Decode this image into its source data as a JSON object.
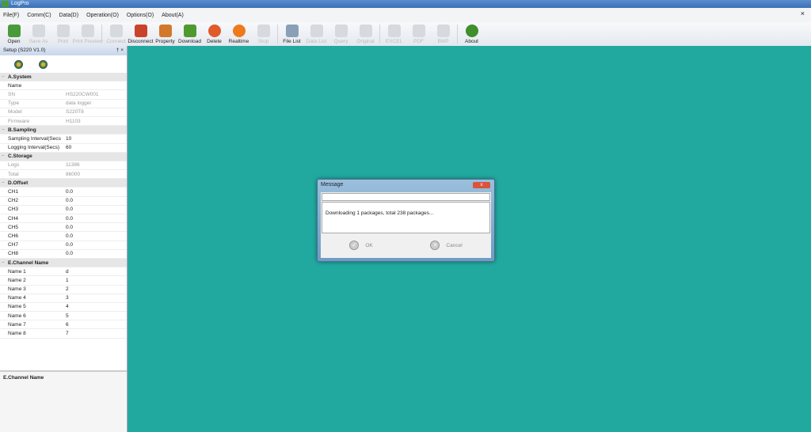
{
  "window": {
    "title": "LogPro"
  },
  "menu": [
    "File(F)",
    "Comm(C)",
    "Data(D)",
    "Operation(O)",
    "Options(O)",
    "About(A)"
  ],
  "toolbar": [
    {
      "label": "Open",
      "enabled": true,
      "color": "#4a9a3a"
    },
    {
      "label": "Save As",
      "enabled": false
    },
    {
      "label": "Print",
      "enabled": false
    },
    {
      "label": "Print Preview",
      "enabled": false
    },
    {
      "label": "Connect",
      "enabled": false
    },
    {
      "label": "Disconnect",
      "enabled": true,
      "color": "#c9432b"
    },
    {
      "label": "Property",
      "enabled": true,
      "color": "#d2782a"
    },
    {
      "label": "Download",
      "enabled": true,
      "color": "#4f9a2f"
    },
    {
      "label": "Delete",
      "enabled": true,
      "color": "#e05a2a"
    },
    {
      "label": "Realtime",
      "enabled": true,
      "color": "#ee7a1a"
    },
    {
      "label": "Stop",
      "enabled": false
    },
    {
      "label": "File List",
      "enabled": true,
      "color": "#8aa0b8"
    },
    {
      "label": "Data List",
      "enabled": false
    },
    {
      "label": "Query",
      "enabled": false
    },
    {
      "label": "Original",
      "enabled": false
    },
    {
      "label": "EXCEL",
      "enabled": false
    },
    {
      "label": "PDF",
      "enabled": false
    },
    {
      "label": "BMP",
      "enabled": false
    },
    {
      "label": "About",
      "enabled": true,
      "color": "#3f8f2a"
    }
  ],
  "panel": {
    "title": "Setup (S220 V1.0)",
    "pin": "† ×",
    "sections": [
      {
        "name": "A.System",
        "rows": [
          [
            "Name",
            "",
            false
          ],
          [
            "SN",
            "HS220CW001",
            true
          ],
          [
            "Type",
            "data logger",
            true
          ],
          [
            "Model",
            "S220T8",
            true
          ],
          [
            "Firmware",
            "H1103",
            true
          ]
        ]
      },
      {
        "name": "B.Sampling",
        "rows": [
          [
            "Sampling Interval(Secs",
            "10",
            false
          ],
          [
            "Logging Interval(Secs)",
            "60",
            false
          ]
        ]
      },
      {
        "name": "C.Storage",
        "rows": [
          [
            "Logs",
            "11386",
            true
          ],
          [
            "Total",
            "86000",
            true
          ]
        ]
      },
      {
        "name": "D.Offset",
        "rows": [
          [
            "CH1",
            "0.0",
            false
          ],
          [
            "CH2",
            "0.0",
            false
          ],
          [
            "CH3",
            "0.0",
            false
          ],
          [
            "CH4",
            "0.0",
            false
          ],
          [
            "CH5",
            "0.0",
            false
          ],
          [
            "CH6",
            "0.0",
            false
          ],
          [
            "CH7",
            "0.0",
            false
          ],
          [
            "CH8",
            "0.0",
            false
          ]
        ]
      },
      {
        "name": "E.Channel Name",
        "rows": [
          [
            "Name 1",
            "d",
            false
          ],
          [
            "Name 2",
            "1",
            false
          ],
          [
            "Name 3",
            "2",
            false
          ],
          [
            "Name 4",
            "3",
            false
          ],
          [
            "Name 5",
            "4",
            false
          ],
          [
            "Name 6",
            "5",
            false
          ],
          [
            "Name 7",
            "6",
            false
          ],
          [
            "Name 8",
            "7",
            false
          ]
        ]
      }
    ],
    "description": "E.Channel Name"
  },
  "dialog": {
    "title": "Message",
    "close": "x",
    "message": "Downloading 1 packages, total 238 packages...",
    "ok": "OK",
    "cancel": "Cancel"
  },
  "colors": {
    "workspace": "#21a9a0"
  }
}
